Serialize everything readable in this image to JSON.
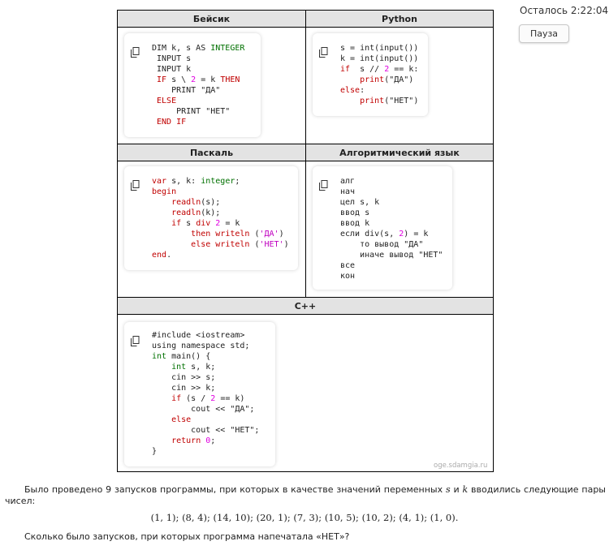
{
  "timer": {
    "label": "Осталось 2:22:04"
  },
  "pause_button": {
    "label": "Пауза"
  },
  "table": {
    "basic": {
      "header": "Бейсик",
      "lines": [
        [
          {
            "t": "DIM k, s AS "
          },
          {
            "t": "INTEGER",
            "c": "ty"
          }
        ],
        [
          {
            "t": " INPUT s"
          }
        ],
        [
          {
            "t": " INPUT k"
          }
        ],
        [
          {
            "t": " IF",
            "c": "kw"
          },
          {
            "t": " s \\ "
          },
          {
            "t": "2",
            "c": "nm"
          },
          {
            "t": " = k "
          },
          {
            "t": "THEN",
            "c": "kw"
          }
        ],
        [
          {
            "t": "    PRINT \"ДА\""
          }
        ],
        [
          {
            "t": " ELSE",
            "c": "kw"
          }
        ],
        [
          {
            "t": "     PRINT \"НЕТ\""
          }
        ],
        [
          {
            "t": " END IF",
            "c": "kw"
          }
        ]
      ]
    },
    "python": {
      "header": "Python",
      "lines": [
        [
          {
            "t": "s = int(input())"
          }
        ],
        [
          {
            "t": "k = int(input())"
          }
        ],
        [
          {
            "t": "if",
            "c": "kw"
          },
          {
            "t": "  s // "
          },
          {
            "t": "2",
            "c": "nm"
          },
          {
            "t": " == k:"
          }
        ],
        [
          {
            "t": "    "
          },
          {
            "t": "print",
            "c": "kw"
          },
          {
            "t": "(\"ДА\")"
          }
        ],
        [
          {
            "t": "else",
            "c": "kw"
          },
          {
            "t": ":"
          }
        ],
        [
          {
            "t": "    "
          },
          {
            "t": "print",
            "c": "kw"
          },
          {
            "t": "(\"НЕТ\")"
          }
        ]
      ]
    },
    "pascal": {
      "header": "Паскаль",
      "lines": [
        [
          {
            "t": "var",
            "c": "kw"
          },
          {
            "t": " s, k: "
          },
          {
            "t": "integer",
            "c": "ty"
          },
          {
            "t": ";"
          }
        ],
        [
          {
            "t": "begin",
            "c": "kw"
          }
        ],
        [
          {
            "t": "    "
          },
          {
            "t": "readln",
            "c": "kw"
          },
          {
            "t": "(s);"
          }
        ],
        [
          {
            "t": "    "
          },
          {
            "t": "readln",
            "c": "kw"
          },
          {
            "t": "(k);"
          }
        ],
        [
          {
            "t": "    "
          },
          {
            "t": "if",
            "c": "kw"
          },
          {
            "t": " s "
          },
          {
            "t": "div",
            "c": "kw"
          },
          {
            "t": " "
          },
          {
            "t": "2",
            "c": "nm"
          },
          {
            "t": " = k"
          }
        ],
        [
          {
            "t": "        "
          },
          {
            "t": "then",
            "c": "kw"
          },
          {
            "t": " "
          },
          {
            "t": "writeln",
            "c": "kw"
          },
          {
            "t": " ("
          },
          {
            "t": "'ДА'",
            "c": "st"
          },
          {
            "t": ")"
          }
        ],
        [
          {
            "t": "        "
          },
          {
            "t": "else",
            "c": "kw"
          },
          {
            "t": " "
          },
          {
            "t": "writeln",
            "c": "kw"
          },
          {
            "t": " ("
          },
          {
            "t": "'НЕТ'",
            "c": "st"
          },
          {
            "t": ")"
          }
        ],
        [
          {
            "t": "end",
            "c": "kw"
          },
          {
            "t": "."
          }
        ]
      ]
    },
    "algo": {
      "header": "Алгоритмический язык",
      "lines": [
        [
          {
            "t": "алг"
          }
        ],
        [
          {
            "t": "нач"
          }
        ],
        [
          {
            "t": "цел s, k"
          }
        ],
        [
          {
            "t": "ввод s"
          }
        ],
        [
          {
            "t": "ввод k"
          }
        ],
        [
          {
            "t": "если div(s, "
          },
          {
            "t": "2",
            "c": "nm"
          },
          {
            "t": ") = k"
          }
        ],
        [
          {
            "t": "    то вывод \"ДА\""
          }
        ],
        [
          {
            "t": "    иначе вывод \"НЕТ\""
          }
        ],
        [
          {
            "t": "все"
          }
        ],
        [
          {
            "t": "кон"
          }
        ]
      ]
    },
    "cpp": {
      "header": "C++",
      "lines": [
        [
          {
            "t": "#include <iostream>"
          }
        ],
        [
          {
            "t": "using namespace std;"
          }
        ],
        [
          {
            "t": "int",
            "c": "ty"
          },
          {
            "t": " main() {"
          }
        ],
        [
          {
            "t": "    "
          },
          {
            "t": "int",
            "c": "ty"
          },
          {
            "t": " s, k;"
          }
        ],
        [
          {
            "t": "    cin >> s;"
          }
        ],
        [
          {
            "t": "    cin >> k;"
          }
        ],
        [
          {
            "t": "    "
          },
          {
            "t": "if",
            "c": "kw"
          },
          {
            "t": " (s / "
          },
          {
            "t": "2",
            "c": "nm"
          },
          {
            "t": " == k)"
          }
        ],
        [
          {
            "t": "        cout << \"ДА\";"
          }
        ],
        [
          {
            "t": "    "
          },
          {
            "t": "else",
            "c": "kw"
          }
        ],
        [
          {
            "t": "        cout << \"НЕТ\";"
          }
        ],
        [
          {
            "t": "    "
          },
          {
            "t": "return",
            "c": "kw"
          },
          {
            "t": " "
          },
          {
            "t": "0",
            "c": "nm"
          },
          {
            "t": ";"
          }
        ],
        [
          {
            "t": "}"
          }
        ]
      ]
    },
    "watermark": "oge.sdamgia.ru"
  },
  "task": {
    "p1_a": "Было проведено 9 запусков программы, при которых в качестве значений переменных ",
    "var_s": "s",
    "p1_b": " и ",
    "var_k": "k",
    "p1_c": " вводились следующие пары чисел:",
    "pairs": "(1, 1); (8, 4); (14, 10); (20, 1); (7, 3); (10, 5); (10, 2); (4, 1); (1, 0).",
    "question": "Сколько было запусков, при которых программа напечатала «НЕТ»?"
  }
}
